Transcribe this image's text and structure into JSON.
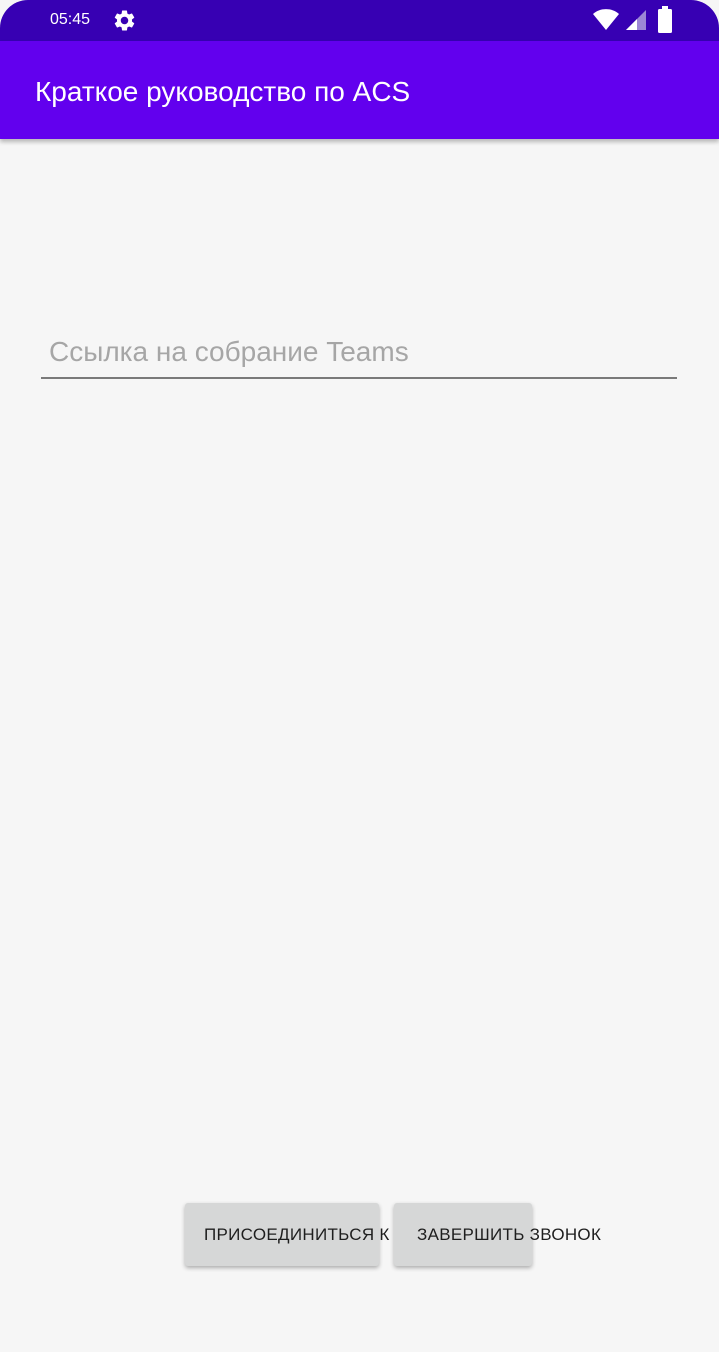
{
  "status_bar": {
    "time": "05:45",
    "icons": [
      "settings-gear-icon",
      "wifi-icon",
      "cell-signal-icon",
      "battery-icon"
    ],
    "color": "#3700B3"
  },
  "app_bar": {
    "title": "Краткое руководство по ACS",
    "color": "#6200EE"
  },
  "meeting_input": {
    "value": "",
    "placeholder": "Ссылка на собрание Teams"
  },
  "buttons": {
    "join_label": "ПРИСОЕДИНИТЬСЯ К СОБРАНИЮ",
    "end_label": "ЗАВЕРШИТЬ ЗВОНОК"
  }
}
